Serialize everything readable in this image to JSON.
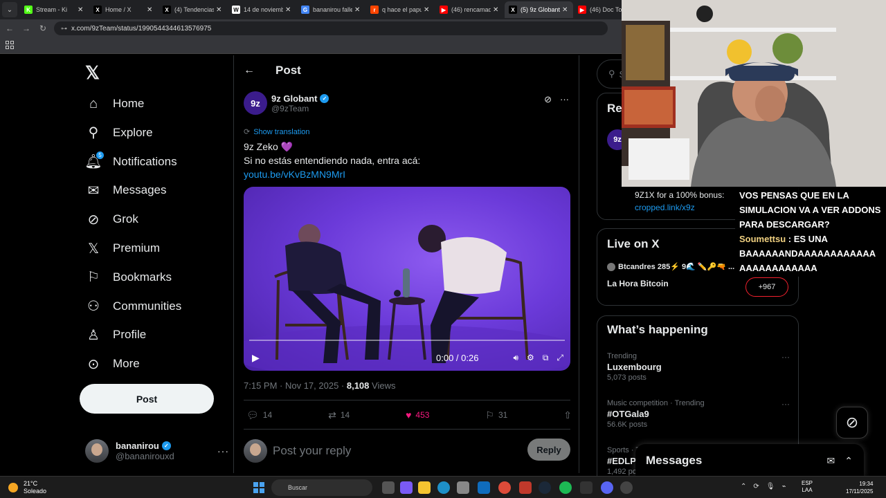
{
  "browser": {
    "tabs": [
      {
        "title": "Stream - Ki",
        "fav_color": "#53fc18",
        "fav_char": "K"
      },
      {
        "title": "Home / X",
        "fav_color": "#000000",
        "fav_char": "X"
      },
      {
        "title": "(4) Tendencias",
        "fav_color": "#000000",
        "fav_char": "X"
      },
      {
        "title": "14 de noviemb",
        "fav_color": "#ffffff",
        "fav_char": "W"
      },
      {
        "title": "bananirou falle",
        "fav_color": "#4285f4",
        "fav_char": "G"
      },
      {
        "title": "q hace el papu",
        "fav_color": "#ff4500",
        "fav_char": "r"
      },
      {
        "title": "(46) rencamad",
        "fav_color": "#ff0000",
        "fav_char": "▶"
      },
      {
        "title": "(5) 9z Globant",
        "fav_color": "#000000",
        "fav_char": "X"
      },
      {
        "title": "(46) Doc Top",
        "fav_color": "#ff0000",
        "fav_char": "▶"
      }
    ],
    "url": "x.com/9zTeam/status/1990544344613576975"
  },
  "nav": {
    "items": [
      {
        "label": "Home",
        "icon": "home-icon",
        "glyph": "⌂"
      },
      {
        "label": "Explore",
        "icon": "search-icon",
        "glyph": "⚲"
      },
      {
        "label": "Notifications",
        "icon": "bell-icon",
        "glyph": "🔔︎"
      },
      {
        "label": "Messages",
        "icon": "envelope-icon",
        "glyph": "✉"
      },
      {
        "label": "Grok",
        "icon": "grok-icon",
        "glyph": "⊘"
      },
      {
        "label": "Premium",
        "icon": "x-premium-icon",
        "glyph": "𝕏"
      },
      {
        "label": "Bookmarks",
        "icon": "bookmark-icon",
        "glyph": "⚐"
      },
      {
        "label": "Communities",
        "icon": "communities-icon",
        "glyph": "⚇"
      },
      {
        "label": "Profile",
        "icon": "person-icon",
        "glyph": "♙"
      },
      {
        "label": "More",
        "icon": "more-circle-icon",
        "glyph": "⊙"
      }
    ],
    "notifications_badge": "5",
    "post_label": "Post",
    "account": {
      "display_name": "bananirou",
      "handle": "@bananirouxd"
    }
  },
  "post": {
    "header_title": "Post",
    "author_name": "9z Globant",
    "author_handle": "@9zTeam",
    "show_translation": "Show translation",
    "line1": "9z Zeko",
    "line1_emoji": "💜",
    "line2": "Si no estás entendiendo nada, entra acá:",
    "link": "youtu.be/vKvBzMN9MrI",
    "video_time": "0:00 / 0:26",
    "video_progress": 0,
    "timestamp": "7:15 PM · Nov 17, 2025 · ",
    "views_count": "8,108",
    "views_label": " Views",
    "replies": "14",
    "reposts": "14",
    "likes": "453",
    "bookmarks": "31",
    "reply_placeholder": "Post your reply",
    "reply_button": "Reply",
    "colors": {
      "like": "#f91880",
      "link": "#1d9bf0"
    }
  },
  "right": {
    "search_placeholder": "S",
    "relevant_title": "Re",
    "promo_line1": "9Z1X for a 100% bonus:",
    "promo_link": "cropped.link/x9z",
    "live_title": "Live on X",
    "live_host": "Btcandres 285⚡ 9🌊 ✏️🔑🔫 ...",
    "live_show": "La Hora Bitcoin",
    "live_count": "+967",
    "happening_title": "What’s happening",
    "trends": [
      {
        "context": "Trending",
        "name": "Luxembourg",
        "count": "5,073 posts"
      },
      {
        "context": "Music competition · Trending",
        "name": "#OTGala9",
        "count": "56.6K posts"
      },
      {
        "context": "Sports · T",
        "name": "#EDLP",
        "count": "1,492 po"
      }
    ]
  },
  "messages_drawer": {
    "title": "Messages"
  },
  "stream_chat": [
    {
      "user": "",
      "text": "VOS PENSAS QUE EN LA SIMULACION VA A VER ADDONS PARA DESCARGAR?"
    },
    {
      "user": "Soumettsu",
      "text": " : ES UNA BAAAAAANDAAAAAAAAAAAA AAAAAAAAAAAA"
    }
  ],
  "taskbar": {
    "temp": "21°C",
    "weather": "Soleado",
    "search_label": "Buscar",
    "lang_1": "ESP",
    "lang_2": "LAA",
    "time": "19:34",
    "date": "17/11/2025"
  }
}
